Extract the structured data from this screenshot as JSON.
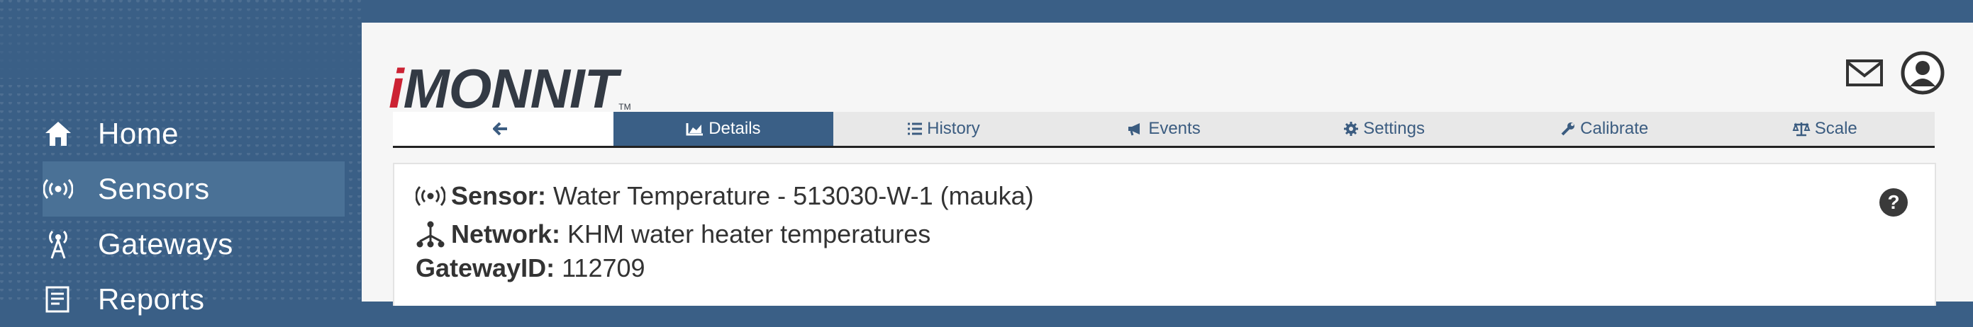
{
  "sidebar": {
    "items": [
      {
        "label": "Home",
        "icon": "home-icon"
      },
      {
        "label": "Sensors",
        "icon": "sensor-icon"
      },
      {
        "label": "Gateways",
        "icon": "gateway-icon"
      },
      {
        "label": "Reports",
        "icon": "reports-icon"
      }
    ],
    "active": "Sensors"
  },
  "header": {
    "logo_prefix": "i",
    "logo_main": "MONNIT",
    "logo_tm": "TM"
  },
  "tabs": [
    {
      "label": "",
      "icon": "arrow-left-icon"
    },
    {
      "label": "Details",
      "icon": "chart-area-icon"
    },
    {
      "label": "History",
      "icon": "list-icon"
    },
    {
      "label": "Events",
      "icon": "bullhorn-icon"
    },
    {
      "label": "Settings",
      "icon": "gear-icon"
    },
    {
      "label": "Calibrate",
      "icon": "wrench-icon"
    },
    {
      "label": "Scale",
      "icon": "scale-icon"
    }
  ],
  "details": {
    "sensor_key": "Sensor:",
    "sensor_value": "Water Temperature - 513030-W-1 (mauka)",
    "network_key": "Network:",
    "network_value": "KHM water heater temperatures",
    "gateway_key": "GatewayID:",
    "gateway_value": "112709",
    "help_label": "?"
  },
  "colors": {
    "brand": "#3a5f86",
    "logo_accent": "#cc2233"
  }
}
